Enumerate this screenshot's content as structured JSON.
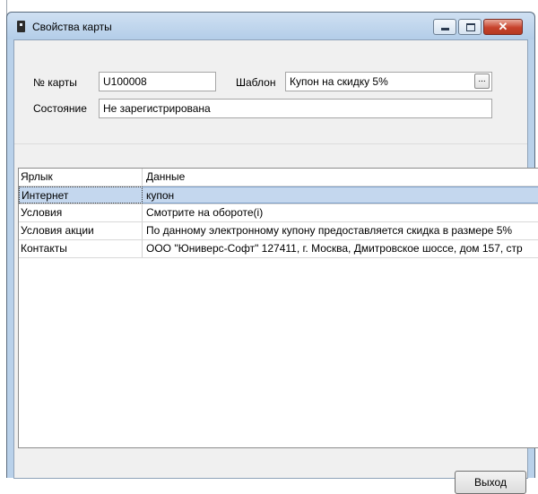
{
  "window": {
    "title": "Свойства карты",
    "close_glyph": "✕"
  },
  "form": {
    "card_no_label": "№ карты",
    "card_no_value": "U100008",
    "template_label": "Шаблон",
    "template_value": "Купон на скидку 5%",
    "browse_label": "...",
    "state_label": "Состояние",
    "state_value": "Не зарегистрирована"
  },
  "grid": {
    "columns": [
      "Ярлык",
      "Данные"
    ],
    "rows": [
      {
        "label": "Интернет",
        "data": "купон",
        "selected": true
      },
      {
        "label": "Условия",
        "data": "Смотрите на обороте(i)",
        "selected": false
      },
      {
        "label": "Условия акции",
        "data": "По данному электронному купону предоставляется скидка в размере  5%",
        "selected": false
      },
      {
        "label": "Контакты",
        "data": "ООО \"Юниверс-Софт\" 127411, г. Москва, Дмитровское шоссе, дом 157, стр",
        "selected": false
      }
    ]
  },
  "footer": {
    "exit_label": "Выход"
  },
  "icons": {
    "window_icon": "card-icon",
    "minimize": "minimize-icon",
    "maximize": "maximize-icon",
    "close": "close-icon"
  },
  "colors": {
    "titlebar": "#b9d1ea",
    "selection": "#c4d7ee",
    "close_button": "#c7422c"
  }
}
